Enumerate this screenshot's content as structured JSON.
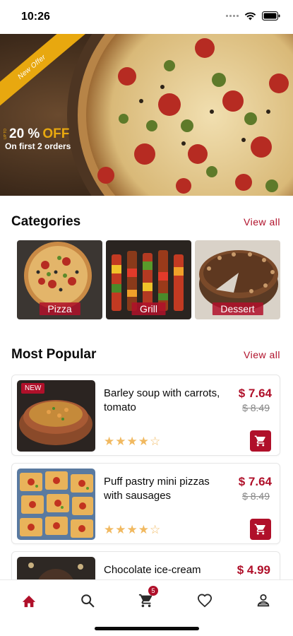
{
  "status_bar": {
    "time": "10:26"
  },
  "hero": {
    "ribbon_text": "New Offer",
    "upto_text": "UP TO",
    "discount_amount": "20 %",
    "discount_off": "OFF",
    "subtitle": "On first 2 orders"
  },
  "categories": {
    "title": "Categories",
    "view_all": "View all",
    "items": [
      {
        "label": "Pizza"
      },
      {
        "label": "Grill"
      },
      {
        "label": "Dessert"
      }
    ]
  },
  "popular": {
    "title": "Most Popular",
    "view_all": "View all",
    "items": [
      {
        "badge": "NEW",
        "name": "Barley soup with carrots, tomato",
        "price": "$ 7.64",
        "old_price": "$ 8.49",
        "rating_stars": "★★★★☆",
        "rating": 4
      },
      {
        "badge": "",
        "name": "Puff pastry mini pizzas with sausages",
        "price": "$ 7.64",
        "old_price": "$ 8.49",
        "rating_stars": "★★★★☆",
        "rating": 4
      },
      {
        "badge": "",
        "name": "Chocolate ice-cream",
        "price": "$ 4.99",
        "old_price": "",
        "rating_stars": "",
        "rating": null
      }
    ]
  },
  "tab_bar": {
    "items": [
      {
        "icon": "home-icon",
        "active": true
      },
      {
        "icon": "search-icon",
        "active": false
      },
      {
        "icon": "cart-icon",
        "active": false,
        "badge": "5"
      },
      {
        "icon": "heart-icon",
        "active": false
      },
      {
        "icon": "profile-icon",
        "active": false
      }
    ]
  },
  "colors": {
    "accent": "#b0102a",
    "offer_gold": "#e8a80f",
    "star": "#f1b960"
  }
}
